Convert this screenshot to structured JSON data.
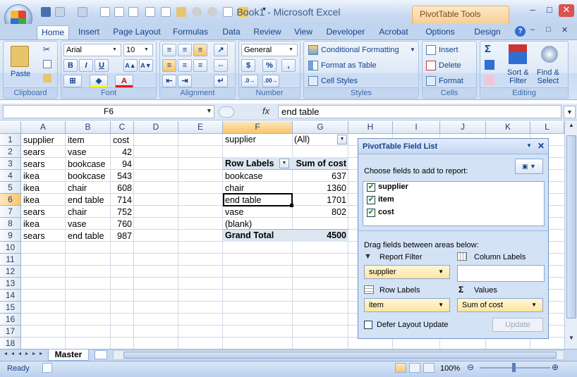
{
  "window": {
    "title": "Book1 - Microsoft Excel",
    "context_tab": "PivotTable Tools"
  },
  "tabs": [
    "Home",
    "Insert",
    "Page Layout",
    "Formulas",
    "Data",
    "Review",
    "View",
    "Developer",
    "Acrobat",
    "Options",
    "Design"
  ],
  "ribbon": {
    "clipboard": {
      "paste": "Paste",
      "label": "Clipboard"
    },
    "font": {
      "name": "Arial",
      "size": "10",
      "label": "Font",
      "bold": "B",
      "italic": "I",
      "underline": "U"
    },
    "alignment": {
      "label": "Alignment"
    },
    "number": {
      "format": "General",
      "label": "Number",
      "currency": "$",
      "percent": "%",
      "comma": ","
    },
    "styles": {
      "cond": "Conditional Formatting",
      "table": "Format as Table",
      "cell": "Cell Styles",
      "label": "Styles"
    },
    "cells": {
      "insert": "Insert",
      "delete": "Delete",
      "format": "Format",
      "label": "Cells"
    },
    "editing": {
      "sum": "Σ",
      "sort": "Sort &\nFilter",
      "find": "Find &\nSelect",
      "label": "Editing"
    }
  },
  "formula_bar": {
    "name_box": "F6",
    "fx": "fx",
    "content": "end table"
  },
  "columns": [
    "A",
    "B",
    "C",
    "D",
    "E",
    "F",
    "G",
    "H",
    "I",
    "J",
    "K",
    "L"
  ],
  "rows": [
    "1",
    "2",
    "3",
    "4",
    "5",
    "6",
    "7",
    "8",
    "9",
    "10",
    "11",
    "12",
    "13",
    "14",
    "15",
    "16",
    "17",
    "18"
  ],
  "data": [
    [
      "supplier",
      "item",
      "cost"
    ],
    [
      "sears",
      "vase",
      "42"
    ],
    [
      "sears",
      "bookcase",
      "94"
    ],
    [
      "ikea",
      "bookcase",
      "543"
    ],
    [
      "ikea",
      "chair",
      "608"
    ],
    [
      "ikea",
      "end table",
      "714"
    ],
    [
      "sears",
      "chair",
      "752"
    ],
    [
      "ikea",
      "vase",
      "760"
    ],
    [
      "sears",
      "end table",
      "987"
    ]
  ],
  "pivot": {
    "filter_label": "supplier",
    "filter_value": "(All)",
    "row_labels": "Row Labels",
    "sum_header": "Sum of cost",
    "rows": [
      [
        "bookcase",
        "637"
      ],
      [
        "chair",
        "1360"
      ],
      [
        "end table",
        "1701"
      ],
      [
        "vase",
        "802"
      ],
      [
        "(blank)",
        ""
      ]
    ],
    "grand_total_label": "Grand Total",
    "grand_total": "4500"
  },
  "field_list": {
    "title": "PivotTable Field List",
    "choose": "Choose fields to add to report:",
    "fields": [
      "supplier",
      "item",
      "cost"
    ],
    "drag": "Drag fields between areas below:",
    "report_filter": "Report Filter",
    "column_labels": "Column Labels",
    "row_labels": "Row Labels",
    "values": "Values",
    "filter_pill": "supplier",
    "row_pill": "item",
    "value_pill": "Sum of cost",
    "defer": "Defer Layout Update",
    "update": "Update"
  },
  "sheet_tab": "Master",
  "status": {
    "ready": "Ready",
    "zoom": "100%"
  }
}
